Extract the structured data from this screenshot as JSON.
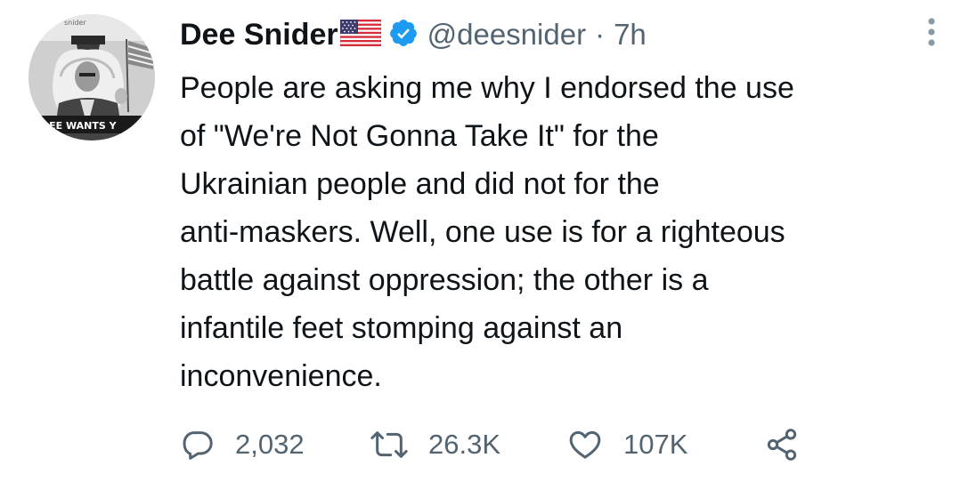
{
  "tweet": {
    "display_name": "Dee Snider",
    "handle": "@deesnider",
    "separator": "·",
    "time": "7h",
    "text": "People are asking me why I endorsed the use\nof \"We're Not Gonna Take It\" for the\nUkrainian people and did not for the\nanti-maskers. Well, one use is for a righteous\nbattle against oppression; the other is a\ninfantile feet stomping against an\ninconvenience.",
    "avatar_caption": "DEE WANTS Y",
    "avatar_top_text": "snider"
  },
  "actions": {
    "replies": "2,032",
    "retweets": "26.3K",
    "likes": "107K"
  },
  "icons": {
    "flag": "us-flag-icon",
    "verified": "verified-badge-icon",
    "more": "more-options-icon",
    "reply": "reply-icon",
    "retweet": "retweet-icon",
    "like": "heart-icon",
    "share": "share-icon"
  },
  "colors": {
    "text": "#0f1419",
    "secondary": "#536471",
    "verified": "#1d9bf0"
  }
}
